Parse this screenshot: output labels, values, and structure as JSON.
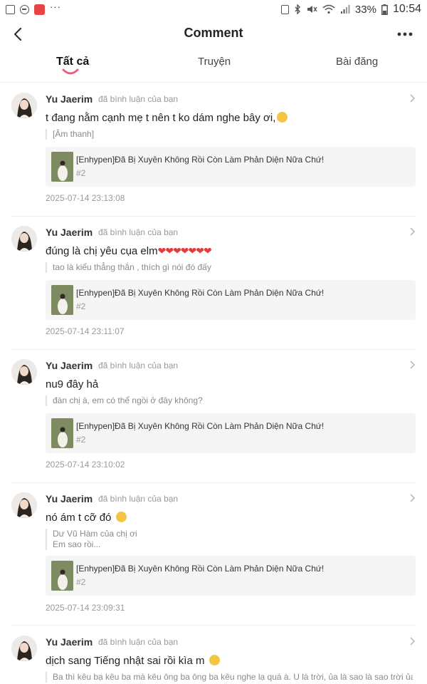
{
  "status_bar": {
    "battery_percent": "33%",
    "time": "10:54",
    "overflow_dots": "···"
  },
  "header": {
    "title": "Comment"
  },
  "tabs": [
    {
      "label": "Tất cả",
      "active": true
    },
    {
      "label": "Truyện",
      "active": false
    },
    {
      "label": "Bài đăng",
      "active": false
    }
  ],
  "comments": [
    {
      "username": "Yu Jaerim",
      "action": "đã bình luận của bạn",
      "text": "t đang nằm cạnh mẹ t nên t ko dám nghe bây ơi,",
      "emoji": "crying-emoji",
      "quote": "[Âm thanh]",
      "story_title": "[Enhypen]Đã Bị Xuyên Không Rồi Còn Làm Phản Diện Nữa Chứ!",
      "story_chapter": "#2",
      "timestamp": "2025-07-14 23:13:08"
    },
    {
      "username": "Yu Jaerim",
      "action": "đã bình luận của bạn",
      "text": "đúng là chị yêu cụa elm",
      "emoji": "hearts",
      "hearts": "❤❤❤❤❤❤❤",
      "quote": "tao là kiểu thẳng thắn , thích gì nói đó đấy",
      "story_title": "[Enhypen]Đã Bị Xuyên Không Rồi Còn Làm Phản Diện Nữa Chứ!",
      "story_chapter": "#2",
      "timestamp": "2025-07-14 23:11:07"
    },
    {
      "username": "Yu Jaerim",
      "action": "đã bình luận của bạn",
      "text": "nu9 đây hả",
      "quote": "đàn chị à, em có thể ngồi ở đây không?",
      "story_title": "[Enhypen]Đã Bị Xuyên Không Rồi Còn Làm Phản Diện Nữa Chứ!",
      "story_chapter": "#2",
      "timestamp": "2025-07-14 23:10:02"
    },
    {
      "username": "Yu Jaerim",
      "action": "đã bình luận của bạn",
      "text": "nó ám t cỡ đó",
      "emoji": "pensive-emoji",
      "quote_line1": "Dư Vũ Hàm của chị ơi",
      "quote_line2": "Em sao rồi...",
      "story_title": "[Enhypen]Đã Bị Xuyên Không Rồi Còn Làm Phản Diện Nữa Chứ!",
      "story_chapter": "#2",
      "timestamp": "2025-07-14 23:09:31"
    },
    {
      "username": "Yu Jaerim",
      "action": "đã bình luận của bạn",
      "text": "dịch sang Tiếng nhật sai rồi kìa m",
      "emoji": "disappointed-emoji",
      "quote": "Ba thì kêu bạ kêu ba mà kêu ông ba ông ba kêu nghe lạ quá à. U là trời, ủa là sao là sao trời ủa"
    }
  ]
}
